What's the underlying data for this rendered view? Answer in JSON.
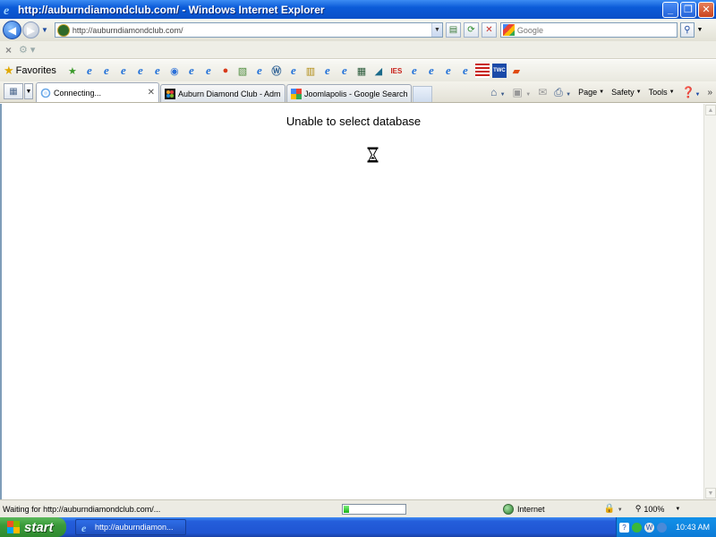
{
  "window": {
    "title": "http://auburndiamondclub.com/ - Windows Internet Explorer",
    "minimize_glyph": "_",
    "maximize_glyph": "❐",
    "close_glyph": "✕"
  },
  "address": {
    "url": "http://auburndiamondclub.com/"
  },
  "search": {
    "placeholder": "Google"
  },
  "favorites": {
    "label": "Favorites",
    "ies_label": "IES",
    "twc_label": "TWC"
  },
  "tabs": [
    {
      "label": "Connecting...",
      "active": true
    },
    {
      "label": "Auburn Diamond Club - Admi...",
      "active": false
    },
    {
      "label": "Joomlapolis - Google Search",
      "active": false
    }
  ],
  "command_bar": {
    "page": "Page",
    "safety": "Safety",
    "tools": "Tools"
  },
  "content": {
    "message": "Unable to select database"
  },
  "status": {
    "text": "Waiting for http://auburndiamondclub.com/...",
    "progress": 0.08,
    "zone": "Internet",
    "zoom": "100%"
  },
  "taskbar": {
    "start": "start",
    "item": "http://auburndiamon...",
    "clock": "10:43 AM"
  },
  "colors": {
    "titlebar": "#0b5bd8",
    "taskbar": "#245edb",
    "start": "#3a9a3a",
    "progress": "#17b217"
  }
}
